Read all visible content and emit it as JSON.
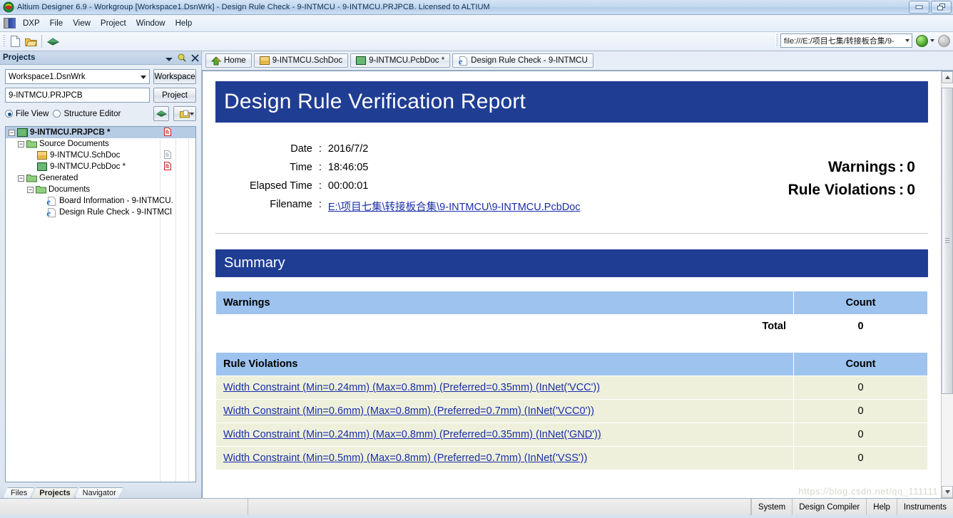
{
  "window": {
    "title": "Altium Designer 6.9 - Workgroup [Workspace1.DsnWrk] - Design Rule Check - 9-INTMCU - 9-INTMCU.PRJPCB. Licensed to ALTIUM",
    "app_icon": "altium-icon",
    "minimize_label": "–",
    "restore_label": "❐"
  },
  "menu": {
    "items": [
      {
        "label": "DXP"
      },
      {
        "label": "File"
      },
      {
        "label": "View"
      },
      {
        "label": "Project"
      },
      {
        "label": "Window"
      },
      {
        "label": "Help"
      }
    ]
  },
  "toolbar": {
    "new_icon": "new-document-icon",
    "open_icon": "open-folder-icon",
    "board_icon": "pcb-board-icon",
    "address_value": "file:///E:/项目七集/转接板合集/9-",
    "back_icon": "navigate-back-icon",
    "forward_icon": "navigate-forward-icon"
  },
  "projects_panel": {
    "title": "Projects",
    "collapse_icon": "chevron-down-icon",
    "pin_icon": "pin-icon",
    "close_icon": "close-icon",
    "workspace_value": "Workspace1.DsnWrk",
    "workspace_button": "Workspace",
    "project_value": "9-INTMCU.PRJPCB",
    "project_button": "Project",
    "file_view_label": "File View",
    "structure_editor_label": "Structure Editor",
    "view_mode_selected": "File View",
    "pcb_view_icon": "pcb-view-icon",
    "options_icon": "project-options-icon",
    "tree": [
      {
        "label": "9-INTMCU.PRJPCB *",
        "icon": "pcb-project-icon",
        "indent": 0,
        "twist": "−",
        "selected": true,
        "right_icon": "red-doc-icon"
      },
      {
        "label": "Source Documents",
        "icon": "folder-icon",
        "indent": 1,
        "twist": "−",
        "selected": false,
        "right_icon": ""
      },
      {
        "label": "9-INTMCU.SchDoc",
        "icon": "schematic-doc-icon",
        "indent": 2,
        "twist": "",
        "selected": false,
        "right_icon": "gray-doc-icon"
      },
      {
        "label": "9-INTMCU.PcbDoc *",
        "icon": "pcb-doc-icon",
        "indent": 2,
        "twist": "",
        "selected": false,
        "right_icon": "red-doc-icon"
      },
      {
        "label": "Generated",
        "icon": "folder-icon",
        "indent": 1,
        "twist": "−",
        "selected": false,
        "right_icon": ""
      },
      {
        "label": "Documents",
        "icon": "folder-icon",
        "indent": 2,
        "twist": "−",
        "selected": false,
        "right_icon": ""
      },
      {
        "label": "Board Information - 9-INTMCU.",
        "icon": "html-doc-icon",
        "indent": 3,
        "twist": "",
        "selected": false,
        "right_icon": ""
      },
      {
        "label": "Design Rule Check - 9-INTMCl",
        "icon": "html-doc-icon",
        "indent": 3,
        "twist": "",
        "selected": false,
        "right_icon": ""
      }
    ],
    "bottom_tabs": [
      {
        "label": "Files",
        "active": false
      },
      {
        "label": "Projects",
        "active": true
      },
      {
        "label": "Navigator",
        "active": false
      }
    ]
  },
  "document_tabs": [
    {
      "label": "Home",
      "icon": "home-icon",
      "active": false
    },
    {
      "label": "9-INTMCU.SchDoc",
      "icon": "schematic-doc-icon",
      "active": false
    },
    {
      "label": "9-INTMCU.PcbDoc *",
      "icon": "pcb-doc-icon",
      "active": false
    },
    {
      "label": "Design Rule Check - 9-INTMCU",
      "icon": "html-doc-icon",
      "active": true
    }
  ],
  "report": {
    "title": "Design Rule Verification Report",
    "meta": [
      {
        "label": "Date",
        "value": "2016/7/2",
        "is_link": false
      },
      {
        "label": "Time",
        "value": "18:46:05",
        "is_link": false
      },
      {
        "label": "Elapsed Time",
        "value": "00:00:01",
        "is_link": false
      },
      {
        "label": "Filename",
        "value": "E:\\项目七集\\转接板合集\\9-INTMCU\\9-INTMCU.PcbDoc",
        "is_link": true
      }
    ],
    "colon": ":",
    "warnings_summary": "Warnings : 0",
    "violations_summary": "Rule Violations : 0",
    "summary_heading": "Summary",
    "warnings_table": {
      "header_label": "Warnings",
      "header_count": "Count",
      "total_label": "Total",
      "total_count": "0"
    },
    "violations_table": {
      "header_label": "Rule Violations",
      "header_count": "Count",
      "rows": [
        {
          "label": "Width Constraint (Min=0.24mm) (Max=0.8mm) (Preferred=0.35mm) (InNet('VCC'))",
          "count": "0"
        },
        {
          "label": "Width Constraint (Min=0.6mm) (Max=0.8mm) (Preferred=0.7mm) (InNet('VCC0'))",
          "count": "0"
        },
        {
          "label": "Width Constraint (Min=0.24mm) (Max=0.8mm) (Preferred=0.35mm) (InNet('GND'))",
          "count": "0"
        },
        {
          "label": "Width Constraint (Min=0.5mm) (Max=0.8mm) (Preferred=0.7mm) (InNet('VSS'))",
          "count": "0"
        }
      ]
    },
    "watermark": "https://blog.csdn.net/qq_111111"
  },
  "status_bar": {
    "left_cells": [
      "",
      ""
    ],
    "right_items": [
      {
        "label": "System"
      },
      {
        "label": "Design Compiler"
      },
      {
        "label": "Help"
      },
      {
        "label": "Instruments"
      }
    ]
  },
  "colors": {
    "banner_blue": "#1f3d93",
    "table_header_blue": "#9dc3ee",
    "row_cream": "#eef0dc",
    "link_blue": "#1a2ea8",
    "tree_selected": "#b6cbe4"
  }
}
